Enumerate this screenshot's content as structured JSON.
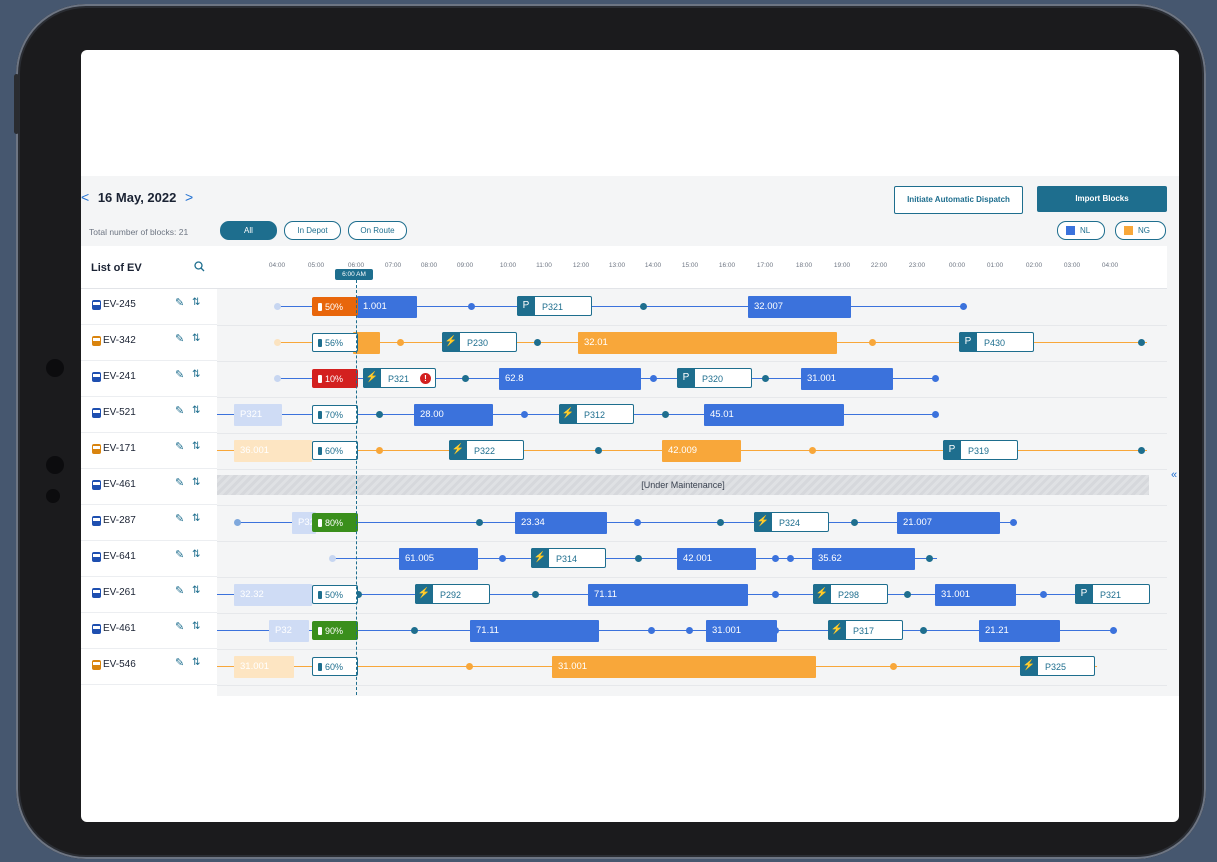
{
  "header": {
    "prev_arrow": "<",
    "date": "16 May, 2022",
    "next_arrow": ">",
    "total_blocks": "Total number of blocks: 21",
    "filters": [
      {
        "label": "All",
        "active": true
      },
      {
        "label": "In Depot",
        "active": false
      },
      {
        "label": "On Route",
        "active": false
      }
    ],
    "initiate_button": "Initiate Automatic Dispatch",
    "import_button": "Import Blocks",
    "legend": [
      {
        "label": "NL",
        "color": "#3b72dc"
      },
      {
        "label": "NG",
        "color": "#f8a73a"
      }
    ]
  },
  "sidebar": {
    "title": "List of EV",
    "search_icon": "search-icon",
    "items": [
      {
        "name": "EV-245",
        "type": "NL"
      },
      {
        "name": "EV-342",
        "type": "NG"
      },
      {
        "name": "EV-241",
        "type": "NL"
      },
      {
        "name": "EV-521",
        "type": "NL"
      },
      {
        "name": "EV-171",
        "type": "NG"
      },
      {
        "name": "EV-461",
        "type": "NL"
      },
      {
        "name": "EV-287",
        "type": "NL"
      },
      {
        "name": "EV-641",
        "type": "NL"
      },
      {
        "name": "EV-261",
        "type": "NL"
      },
      {
        "name": "EV-461",
        "type": "NL"
      },
      {
        "name": "EV-546",
        "type": "NG"
      }
    ]
  },
  "timeline": {
    "ticks": [
      "04:00",
      "05:00",
      "06:00",
      "07:00",
      "08:00",
      "09:00",
      "10:00",
      "11:00",
      "12:00",
      "13:00",
      "14:00",
      "15:00",
      "16:00",
      "17:00",
      "18:00",
      "19:00",
      "22:00",
      "23:00",
      "00:00",
      "01:00",
      "02:00",
      "03:00",
      "04:00"
    ],
    "now_label": "6:00 AM",
    "maintenance_label": "[Under Maintenance]"
  },
  "rows": [
    {
      "battery": "50%",
      "blocks": [
        "1.001",
        "32.007"
      ],
      "parking": [
        "P321"
      ]
    },
    {
      "battery": "56%",
      "blocks": [
        "32.01"
      ],
      "parking": [
        "P230",
        "P430"
      ]
    },
    {
      "battery": "10%",
      "blocks": [
        "62.8",
        "31.001"
      ],
      "parking": [
        "P321",
        "P320"
      ],
      "warning": "!"
    },
    {
      "battery": "70%",
      "blocks": [
        "28.00",
        "45.01"
      ],
      "parking": [
        "P321",
        "P312"
      ]
    },
    {
      "battery": "60%",
      "blocks": [
        "36.001",
        "42.009"
      ],
      "parking": [
        "P322",
        "P319"
      ]
    },
    {
      "battery": "",
      "blocks": [],
      "parking": []
    },
    {
      "battery": "80%",
      "blocks": [
        "23.34",
        "21.007"
      ],
      "parking": [
        "P324"
      ]
    },
    {
      "battery": "",
      "blocks": [
        "61.005",
        "42.001",
        "35.62"
      ],
      "parking": [
        "P314"
      ]
    },
    {
      "battery": "50%",
      "blocks": [
        "32.32",
        "71.11",
        "31.001"
      ],
      "parking": [
        "P292",
        "P298",
        "P321"
      ]
    },
    {
      "battery": "90%",
      "blocks": [
        "71.11",
        "31.001",
        "21.21"
      ],
      "parking": [
        "P32",
        "P317"
      ]
    },
    {
      "battery": "60%",
      "blocks": [
        "31.001",
        "31.001"
      ],
      "parking": [
        "P325"
      ]
    }
  ],
  "colors": {
    "primary": "#1e6e8e",
    "nl_block": "#3b72dc",
    "ng_block": "#f8a73a",
    "warning": "#d3201f"
  }
}
